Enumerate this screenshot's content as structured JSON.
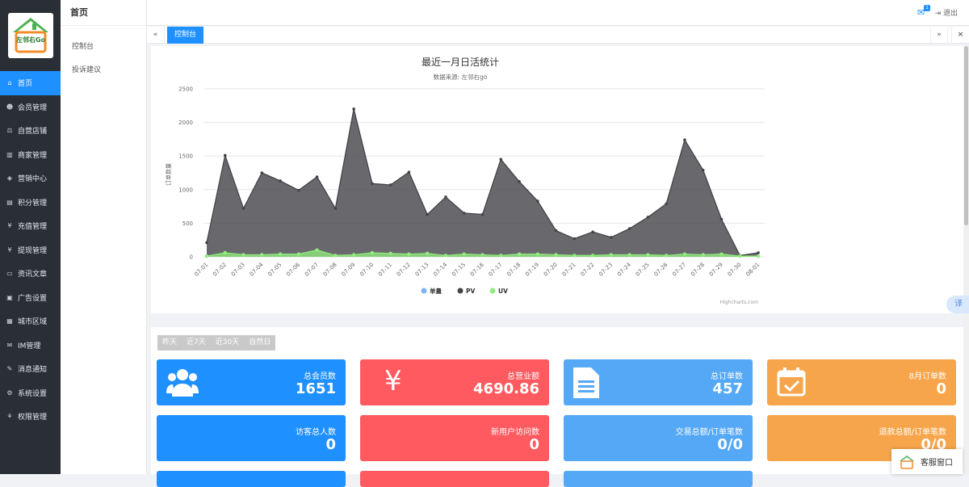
{
  "brand": {
    "logo_text": "左邻右Go"
  },
  "sidebar": {
    "items": [
      {
        "label": "首页",
        "icon": "home-icon",
        "glyph": "⌂",
        "active": true
      },
      {
        "label": "会员管理",
        "icon": "users-icon",
        "glyph": "☻"
      },
      {
        "label": "自营店铺",
        "icon": "balance-icon",
        "glyph": "⚖"
      },
      {
        "label": "商家管理",
        "icon": "bank-icon",
        "glyph": "▥"
      },
      {
        "label": "营销中心",
        "icon": "tag-icon",
        "glyph": "◈"
      },
      {
        "label": "积分管理",
        "icon": "document-icon",
        "glyph": "▤"
      },
      {
        "label": "充值管理",
        "icon": "yen-icon",
        "glyph": "¥"
      },
      {
        "label": "提现管理",
        "icon": "yen-icon",
        "glyph": "¥"
      },
      {
        "label": "资讯文章",
        "icon": "card-icon",
        "glyph": "▭"
      },
      {
        "label": "广告设置",
        "icon": "image-icon",
        "glyph": "▣"
      },
      {
        "label": "城市区域",
        "icon": "map-icon",
        "glyph": "▦"
      },
      {
        "label": "IM管理",
        "icon": "chat-icon",
        "glyph": "✉"
      },
      {
        "label": "消息通知",
        "icon": "comment-icon",
        "glyph": "✎"
      },
      {
        "label": "系统设置",
        "icon": "gear-icon",
        "glyph": "⚙"
      },
      {
        "label": "权限管理",
        "icon": "sitemap-icon",
        "glyph": "⚘"
      }
    ]
  },
  "subnav": {
    "title": "首页",
    "items": [
      "控制台",
      "投诉建议"
    ]
  },
  "topbar": {
    "badge": "1",
    "logout": "退出"
  },
  "tabs": {
    "active": "控制台"
  },
  "chart_data": {
    "type": "area",
    "title": "最近一月日活统计",
    "subtitle": "数据来源: 左邻右go",
    "ylabel": "订单数量",
    "ylim": [
      0,
      2500
    ],
    "yticks": [
      0,
      500,
      1000,
      1500,
      2000,
      2500
    ],
    "credit": "Highcharts.com",
    "x": [
      "07-01",
      "07-02",
      "07-03",
      "07-04",
      "07-05",
      "07-06",
      "07-07",
      "07-08",
      "07-09",
      "07-10",
      "07-11",
      "07-12",
      "07-13",
      "07-14",
      "07-15",
      "07-16",
      "07-17",
      "07-18",
      "07-19",
      "07-20",
      "07-21",
      "07-22",
      "07-23",
      "07-24",
      "07-25",
      "07-26",
      "07-27",
      "07-28",
      "07-29",
      "07-30",
      "08-01"
    ],
    "series": [
      {
        "name": "单量",
        "color": "#7cb5ec",
        "values": [
          0,
          0,
          0,
          0,
          0,
          0,
          0,
          0,
          0,
          0,
          0,
          0,
          0,
          0,
          0,
          0,
          0,
          0,
          0,
          0,
          0,
          0,
          0,
          0,
          0,
          0,
          0,
          0,
          0,
          0,
          0
        ]
      },
      {
        "name": "PV",
        "color": "#434348",
        "values": [
          210,
          1510,
          720,
          1250,
          1130,
          990,
          1190,
          720,
          2200,
          1090,
          1070,
          1260,
          630,
          890,
          650,
          630,
          1450,
          1120,
          830,
          390,
          270,
          370,
          290,
          420,
          590,
          790,
          1740,
          1290,
          560,
          20,
          60
        ]
      },
      {
        "name": "UV",
        "color": "#90ed7d",
        "values": [
          10,
          60,
          30,
          30,
          40,
          40,
          100,
          20,
          30,
          60,
          50,
          40,
          50,
          20,
          40,
          30,
          20,
          40,
          40,
          30,
          20,
          20,
          30,
          30,
          30,
          20,
          40,
          30,
          40,
          10,
          10
        ]
      }
    ],
    "legend": "bottom-center"
  },
  "stats": {
    "filters": [
      "昨天",
      "近7天",
      "近30天",
      "自然日"
    ],
    "cards": [
      {
        "label": "总会员数",
        "value": "1651",
        "color": "blue",
        "icon": "users-icon"
      },
      {
        "label": "总营业额",
        "value": "4690.86",
        "color": "red",
        "icon": "yen-icon"
      },
      {
        "label": "总订单数",
        "value": "457",
        "color": "lblue",
        "icon": "document-icon"
      },
      {
        "label": "8月订单数",
        "value": "0",
        "color": "orange",
        "icon": "calendar-check-icon"
      },
      {
        "label": "访客总人数",
        "value": "0",
        "color": "blue"
      },
      {
        "label": "新用户访问数",
        "value": "0",
        "color": "red"
      },
      {
        "label": "交易总额/订单笔数",
        "value": "0/0",
        "color": "lblue"
      },
      {
        "label": "退款总额/订单笔数",
        "value": "0/0",
        "color": "orange"
      }
    ]
  },
  "widgets": {
    "kefu": "客服窗口",
    "translate": "译"
  }
}
